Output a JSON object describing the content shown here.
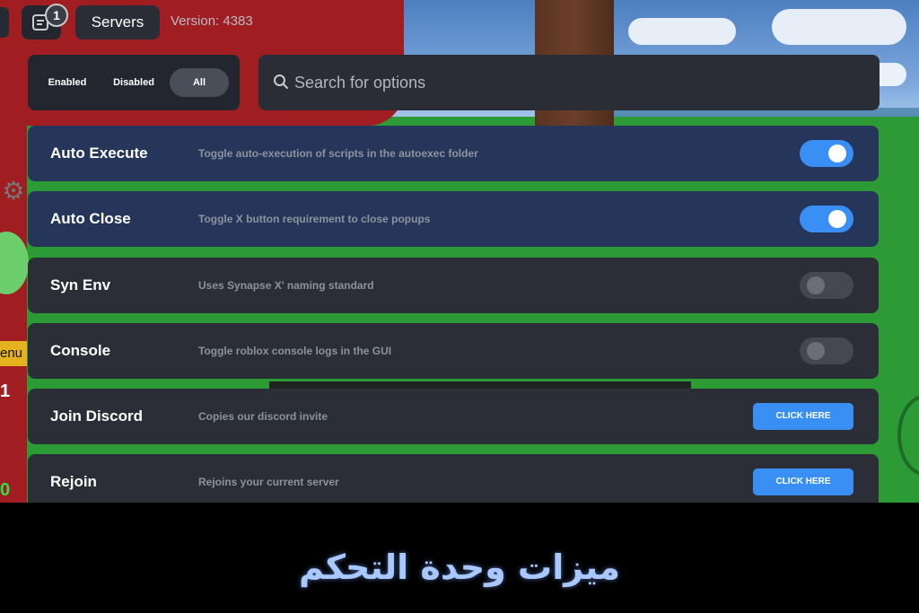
{
  "topbar": {
    "notification_count": "1",
    "servers_label": "Servers",
    "version": "Version: 4383"
  },
  "filter": {
    "tabs": [
      {
        "label": "Enabled",
        "active": false
      },
      {
        "label": "Disabled",
        "active": false
      },
      {
        "label": "All",
        "active": true
      }
    ]
  },
  "search": {
    "placeholder": "Search for options",
    "value": ""
  },
  "options": [
    {
      "title": "Auto Execute",
      "description": "Toggle auto-execution of scripts in the autoexec folder",
      "control": "toggle",
      "enabled": true
    },
    {
      "title": "Auto Close",
      "description": "Toggle X button requirement to close popups",
      "control": "toggle",
      "enabled": true
    },
    {
      "title": "Syn Env",
      "description": "Uses Synapse X' naming standard",
      "control": "toggle",
      "enabled": false
    },
    {
      "title": "Console",
      "description": "Toggle roblox console logs in the GUI",
      "control": "toggle",
      "enabled": false
    },
    {
      "title": "Join Discord",
      "description": "Copies our discord invite",
      "control": "button",
      "button_label": "CLICK HERE"
    },
    {
      "title": "Rejoin",
      "description": "Rejoins your current server",
      "control": "button",
      "button_label": "CLICK HERE"
    }
  ],
  "game_overlay": {
    "menu_fragment": "enu",
    "left_number": "1",
    "left_zero": "0"
  },
  "caption": "ميزات وحدة التحكم",
  "colors": {
    "accent_blue": "#3a8ff5",
    "row_enabled": "#26365a",
    "row_default": "#2b2e36",
    "caption_text": "#a9c8ff"
  },
  "icons": {
    "notifications": "notes-icon",
    "search": "search-icon",
    "settings": "gear-icon"
  }
}
